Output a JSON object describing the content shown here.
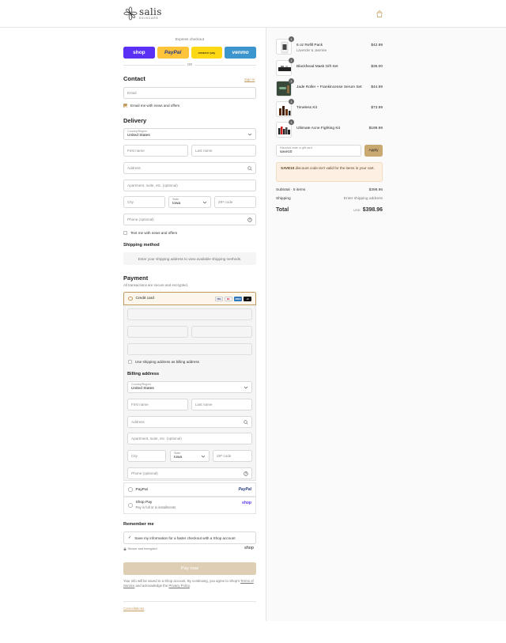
{
  "brand": {
    "name": "salis",
    "tagline": "SKINCARE"
  },
  "express": {
    "label": "Express checkout",
    "buttons": [
      "shop",
      "PayPal",
      "amazon pay",
      "venmo"
    ],
    "or": "OR"
  },
  "contact": {
    "heading": "Contact",
    "sign_in": "Sign in",
    "email_placeholder": "Email",
    "newsletter": "Email me with news and offers"
  },
  "delivery": {
    "heading": "Delivery",
    "country_label": "Country/Region",
    "country_value": "United States",
    "first_name": "First name",
    "last_name": "Last name",
    "address": "Address",
    "apartment": "Apartment, suite, etc. (optional)",
    "city": "City",
    "state_label": "State",
    "state_value": "Iowa",
    "zip": "ZIP code",
    "phone": "Phone (optional)",
    "text_me": "Text me with news and offers"
  },
  "shipping": {
    "heading": "Shipping method",
    "note": "Enter your shipping address to view available shipping methods."
  },
  "payment": {
    "heading": "Payment",
    "subtitle": "All transactions are secure and encrypted.",
    "credit_card": "Credit card",
    "card_brands": [
      "VISA",
      "MC",
      "AMEX",
      "+4"
    ],
    "use_shipping": "Use shipping address as billing address",
    "billing_heading": "Billing address",
    "paypal": "PayPal",
    "paypal_logo": "PayPal",
    "shop_pay": "Shop Pay",
    "shop_pay_sub": "Pay in full or in installments",
    "shop_logo": "shop"
  },
  "remember": {
    "heading": "Remember me",
    "save_info": "Save my information for a faster checkout with a Shop account",
    "secure": "Secure and encrypted",
    "shop_logo": "shop"
  },
  "pay_now": "Pay now",
  "fine_print": {
    "line1": "Your info will be saved to a Shop account. By continuing, you agree to Shop's",
    "terms": "Terms of Service",
    "mid": " and acknowledge the ",
    "privacy": "Privacy Policy",
    "end": "."
  },
  "cancellations": "Cancellations",
  "cart": {
    "items": [
      {
        "name": "6 oz Refill Pack",
        "variant": "Lavender & Jasmine",
        "price": "$42.99",
        "qty": "1"
      },
      {
        "name": "Blackhead Mask Gift Set",
        "variant": "",
        "price": "$36.00",
        "qty": "1"
      },
      {
        "name": "Jade Roller + Frankincense Serum Set",
        "variant": "",
        "price": "$44.99",
        "qty": "1"
      },
      {
        "name": "Timeless Kit",
        "variant": "",
        "price": "$73.99",
        "qty": "1"
      },
      {
        "name": "Ultimate Acne Fighting Kit",
        "variant": "",
        "price": "$199.99",
        "qty": "1"
      }
    ],
    "discount_label": "Discount code or gift card",
    "discount_value": "save10",
    "apply": "Apply",
    "warning_code": "SAVE10",
    "warning_text": " discount code isn't valid for the items in your cart.",
    "subtotal_label": "Subtotal · 5 items",
    "subtotal_value": "$398.96",
    "shipping_label": "Shipping",
    "shipping_value": "Enter shipping address",
    "total_label": "Total",
    "currency": "USD",
    "total_value": "$398.96"
  },
  "colors": {
    "accent": "#c19a5b",
    "shop": "#5a31f4",
    "paypal": "#ffc439",
    "amazon": "#ffd814",
    "venmo": "#3d95ce"
  }
}
